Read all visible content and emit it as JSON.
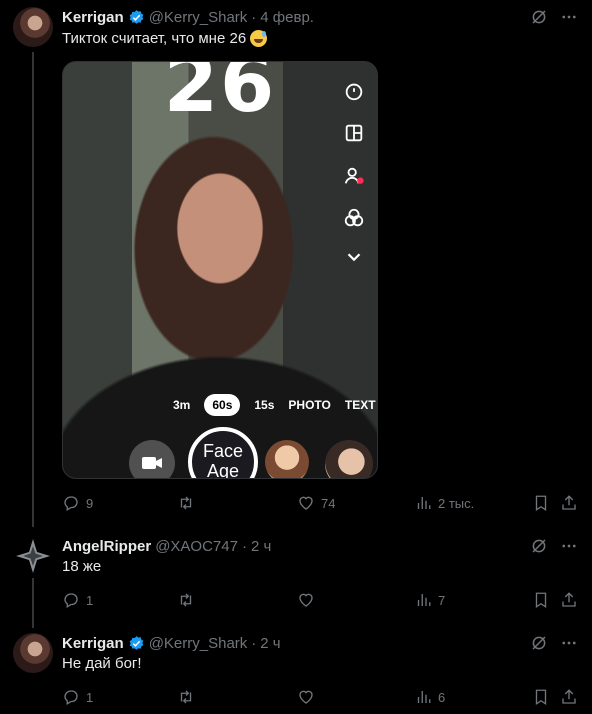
{
  "tweets": [
    {
      "name": "Kerrigan",
      "handle": "@Kerry_Shark",
      "sep": "·",
      "time": "4 февр.",
      "text": "Тикток считает, что мне 26",
      "emoji": "sweat-smile-emoji",
      "replies": "9",
      "retweets": "",
      "likes": "74",
      "views": "2 тыс."
    },
    {
      "name": "AngelRipper",
      "handle": "@XAOC747",
      "sep": "·",
      "time": "2 ч",
      "text": "18 же",
      "replies": "1",
      "retweets": "",
      "likes": "",
      "views": "7"
    },
    {
      "name": "Kerrigan",
      "handle": "@Kerry_Shark",
      "sep": "·",
      "time": "2 ч",
      "text": "Не дай бог!",
      "replies": "1",
      "retweets": "",
      "likes": "",
      "views": "6"
    }
  ],
  "media": {
    "age_number": "26",
    "modes": [
      "3m",
      "60s",
      "15s",
      "PHOTO",
      "TEXT"
    ],
    "active_mode": "60s",
    "effect_line1": "Face",
    "effect_line2": "Age"
  },
  "colors": {
    "background": "#000000",
    "text": "#e7e9ea",
    "secondary": "#71767b",
    "verified": "#1d9bf0"
  }
}
